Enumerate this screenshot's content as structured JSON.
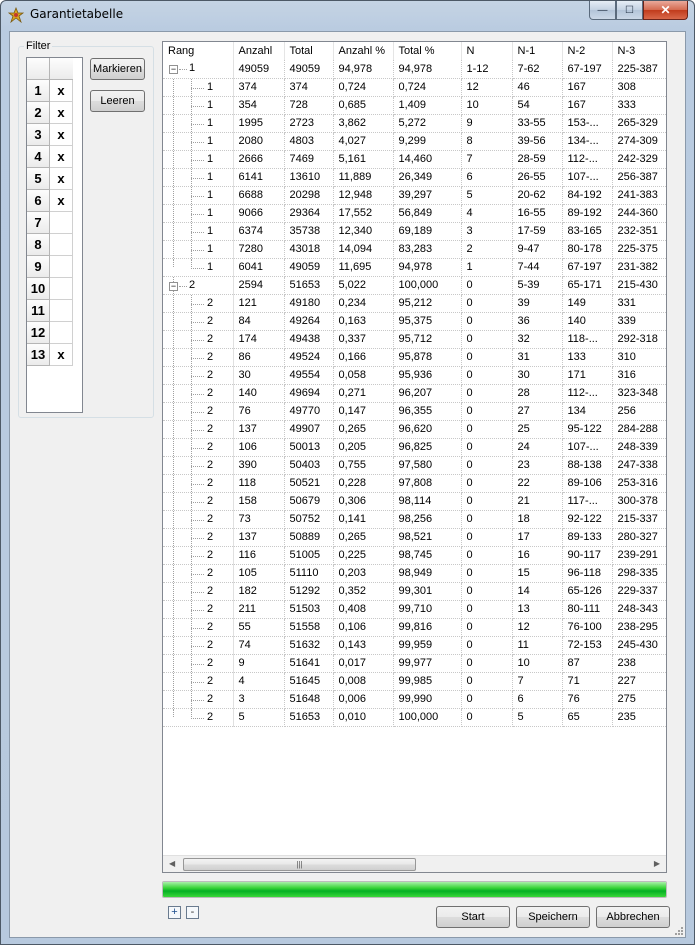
{
  "window": {
    "title": "Garantietabelle",
    "icon": "crown-star-icon",
    "caption_buttons": {
      "minimize": "—",
      "maximize": "☐",
      "close": "✕"
    }
  },
  "filter": {
    "label": "Filter",
    "rows": [
      {
        "n": "1",
        "mark": "x"
      },
      {
        "n": "2",
        "mark": "x"
      },
      {
        "n": "3",
        "mark": "x"
      },
      {
        "n": "4",
        "mark": "x"
      },
      {
        "n": "5",
        "mark": "x"
      },
      {
        "n": "6",
        "mark": "x"
      },
      {
        "n": "7",
        "mark": ""
      },
      {
        "n": "8",
        "mark": ""
      },
      {
        "n": "9",
        "mark": ""
      },
      {
        "n": "10",
        "mark": ""
      },
      {
        "n": "11",
        "mark": ""
      },
      {
        "n": "12",
        "mark": ""
      },
      {
        "n": "13",
        "mark": "x"
      }
    ],
    "mark_button": "Markieren",
    "clear_button": "Leeren"
  },
  "table": {
    "columns": [
      "Rang",
      "Anzahl",
      "Total",
      "Anzahl %",
      "Total %",
      "N",
      "N-1",
      "N-2",
      "N-3"
    ],
    "rows": [
      {
        "level": 0,
        "expander": "−",
        "cells": [
          "1",
          "49059",
          "49059",
          "94,978",
          "94,978",
          "1-12",
          "7-62",
          "67-197",
          "225-387"
        ]
      },
      {
        "level": 1,
        "cells": [
          "1",
          "374",
          "374",
          "0,724",
          "0,724",
          "12",
          "46",
          "167",
          "308"
        ]
      },
      {
        "level": 1,
        "cells": [
          "1",
          "354",
          "728",
          "0,685",
          "1,409",
          "10",
          "54",
          "167",
          "333"
        ]
      },
      {
        "level": 1,
        "cells": [
          "1",
          "1995",
          "2723",
          "3,862",
          "5,272",
          "9",
          "33-55",
          "153-...",
          "265-329"
        ]
      },
      {
        "level": 1,
        "cells": [
          "1",
          "2080",
          "4803",
          "4,027",
          "9,299",
          "8",
          "39-56",
          "134-...",
          "274-309"
        ]
      },
      {
        "level": 1,
        "cells": [
          "1",
          "2666",
          "7469",
          "5,161",
          "14,460",
          "7",
          "28-59",
          "112-...",
          "242-329"
        ]
      },
      {
        "level": 1,
        "cells": [
          "1",
          "6141",
          "13610",
          "11,889",
          "26,349",
          "6",
          "26-55",
          "107-...",
          "256-387"
        ]
      },
      {
        "level": 1,
        "cells": [
          "1",
          "6688",
          "20298",
          "12,948",
          "39,297",
          "5",
          "20-62",
          "84-192",
          "241-383"
        ]
      },
      {
        "level": 1,
        "cells": [
          "1",
          "9066",
          "29364",
          "17,552",
          "56,849",
          "4",
          "16-55",
          "89-192",
          "244-360"
        ]
      },
      {
        "level": 1,
        "cells": [
          "1",
          "6374",
          "35738",
          "12,340",
          "69,189",
          "3",
          "17-59",
          "83-165",
          "232-351"
        ]
      },
      {
        "level": 1,
        "cells": [
          "1",
          "7280",
          "43018",
          "14,094",
          "83,283",
          "2",
          "9-47",
          "80-178",
          "225-375"
        ]
      },
      {
        "level": 1,
        "last": true,
        "cells": [
          "1",
          "6041",
          "49059",
          "11,695",
          "94,978",
          "1",
          "7-44",
          "67-197",
          "231-382"
        ]
      },
      {
        "level": 0,
        "expander": "−",
        "cells": [
          "2",
          "2594",
          "51653",
          "5,022",
          "100,000",
          "0",
          "5-39",
          "65-171",
          "215-430"
        ]
      },
      {
        "level": 1,
        "cells": [
          "2",
          "121",
          "49180",
          "0,234",
          "95,212",
          "0",
          "39",
          "149",
          "331"
        ]
      },
      {
        "level": 1,
        "cells": [
          "2",
          "84",
          "49264",
          "0,163",
          "95,375",
          "0",
          "36",
          "140",
          "339"
        ]
      },
      {
        "level": 1,
        "cells": [
          "2",
          "174",
          "49438",
          "0,337",
          "95,712",
          "0",
          "32",
          "118-...",
          "292-318"
        ]
      },
      {
        "level": 1,
        "cells": [
          "2",
          "86",
          "49524",
          "0,166",
          "95,878",
          "0",
          "31",
          "133",
          "310"
        ]
      },
      {
        "level": 1,
        "cells": [
          "2",
          "30",
          "49554",
          "0,058",
          "95,936",
          "0",
          "30",
          "171",
          "316"
        ]
      },
      {
        "level": 1,
        "cells": [
          "2",
          "140",
          "49694",
          "0,271",
          "96,207",
          "0",
          "28",
          "112-...",
          "323-348"
        ]
      },
      {
        "level": 1,
        "cells": [
          "2",
          "76",
          "49770",
          "0,147",
          "96,355",
          "0",
          "27",
          "134",
          "256"
        ]
      },
      {
        "level": 1,
        "cells": [
          "2",
          "137",
          "49907",
          "0,265",
          "96,620",
          "0",
          "25",
          "95-122",
          "284-288"
        ]
      },
      {
        "level": 1,
        "cells": [
          "2",
          "106",
          "50013",
          "0,205",
          "96,825",
          "0",
          "24",
          "107-...",
          "248-339"
        ]
      },
      {
        "level": 1,
        "cells": [
          "2",
          "390",
          "50403",
          "0,755",
          "97,580",
          "0",
          "23",
          "88-138",
          "247-338"
        ]
      },
      {
        "level": 1,
        "cells": [
          "2",
          "118",
          "50521",
          "0,228",
          "97,808",
          "0",
          "22",
          "89-106",
          "253-316"
        ]
      },
      {
        "level": 1,
        "cells": [
          "2",
          "158",
          "50679",
          "0,306",
          "98,114",
          "0",
          "21",
          "117-...",
          "300-378"
        ]
      },
      {
        "level": 1,
        "cells": [
          "2",
          "73",
          "50752",
          "0,141",
          "98,256",
          "0",
          "18",
          "92-122",
          "215-337"
        ]
      },
      {
        "level": 1,
        "cells": [
          "2",
          "137",
          "50889",
          "0,265",
          "98,521",
          "0",
          "17",
          "89-133",
          "280-327"
        ]
      },
      {
        "level": 1,
        "cells": [
          "2",
          "116",
          "51005",
          "0,225",
          "98,745",
          "0",
          "16",
          "90-117",
          "239-291"
        ]
      },
      {
        "level": 1,
        "cells": [
          "2",
          "105",
          "51110",
          "0,203",
          "98,949",
          "0",
          "15",
          "96-118",
          "298-335"
        ]
      },
      {
        "level": 1,
        "cells": [
          "2",
          "182",
          "51292",
          "0,352",
          "99,301",
          "0",
          "14",
          "65-126",
          "229-337"
        ]
      },
      {
        "level": 1,
        "cells": [
          "2",
          "211",
          "51503",
          "0,408",
          "99,710",
          "0",
          "13",
          "80-111",
          "248-343"
        ]
      },
      {
        "level": 1,
        "cells": [
          "2",
          "55",
          "51558",
          "0,106",
          "99,816",
          "0",
          "12",
          "76-100",
          "238-295"
        ]
      },
      {
        "level": 1,
        "cells": [
          "2",
          "74",
          "51632",
          "0,143",
          "99,959",
          "0",
          "11",
          "72-153",
          "245-430"
        ]
      },
      {
        "level": 1,
        "cells": [
          "2",
          "9",
          "51641",
          "0,017",
          "99,977",
          "0",
          "10",
          "87",
          "238"
        ]
      },
      {
        "level": 1,
        "cells": [
          "2",
          "4",
          "51645",
          "0,008",
          "99,985",
          "0",
          "7",
          "71",
          "227"
        ]
      },
      {
        "level": 1,
        "cells": [
          "2",
          "3",
          "51648",
          "0,006",
          "99,990",
          "0",
          "6",
          "76",
          "275"
        ]
      },
      {
        "level": 1,
        "last": true,
        "cells": [
          "2",
          "5",
          "51653",
          "0,010",
          "100,000",
          "0",
          "5",
          "65",
          "235"
        ]
      }
    ],
    "scrollbar": {
      "left_arrow": "◀",
      "right_arrow": "▶",
      "grip": "|||"
    }
  },
  "progress": {
    "value_percent": 100,
    "color": "#06b025"
  },
  "footer": {
    "expand_all": "+",
    "collapse_all": "-",
    "start_button": "Start",
    "save_button": "Speichern",
    "cancel_button": "Abbrechen"
  }
}
